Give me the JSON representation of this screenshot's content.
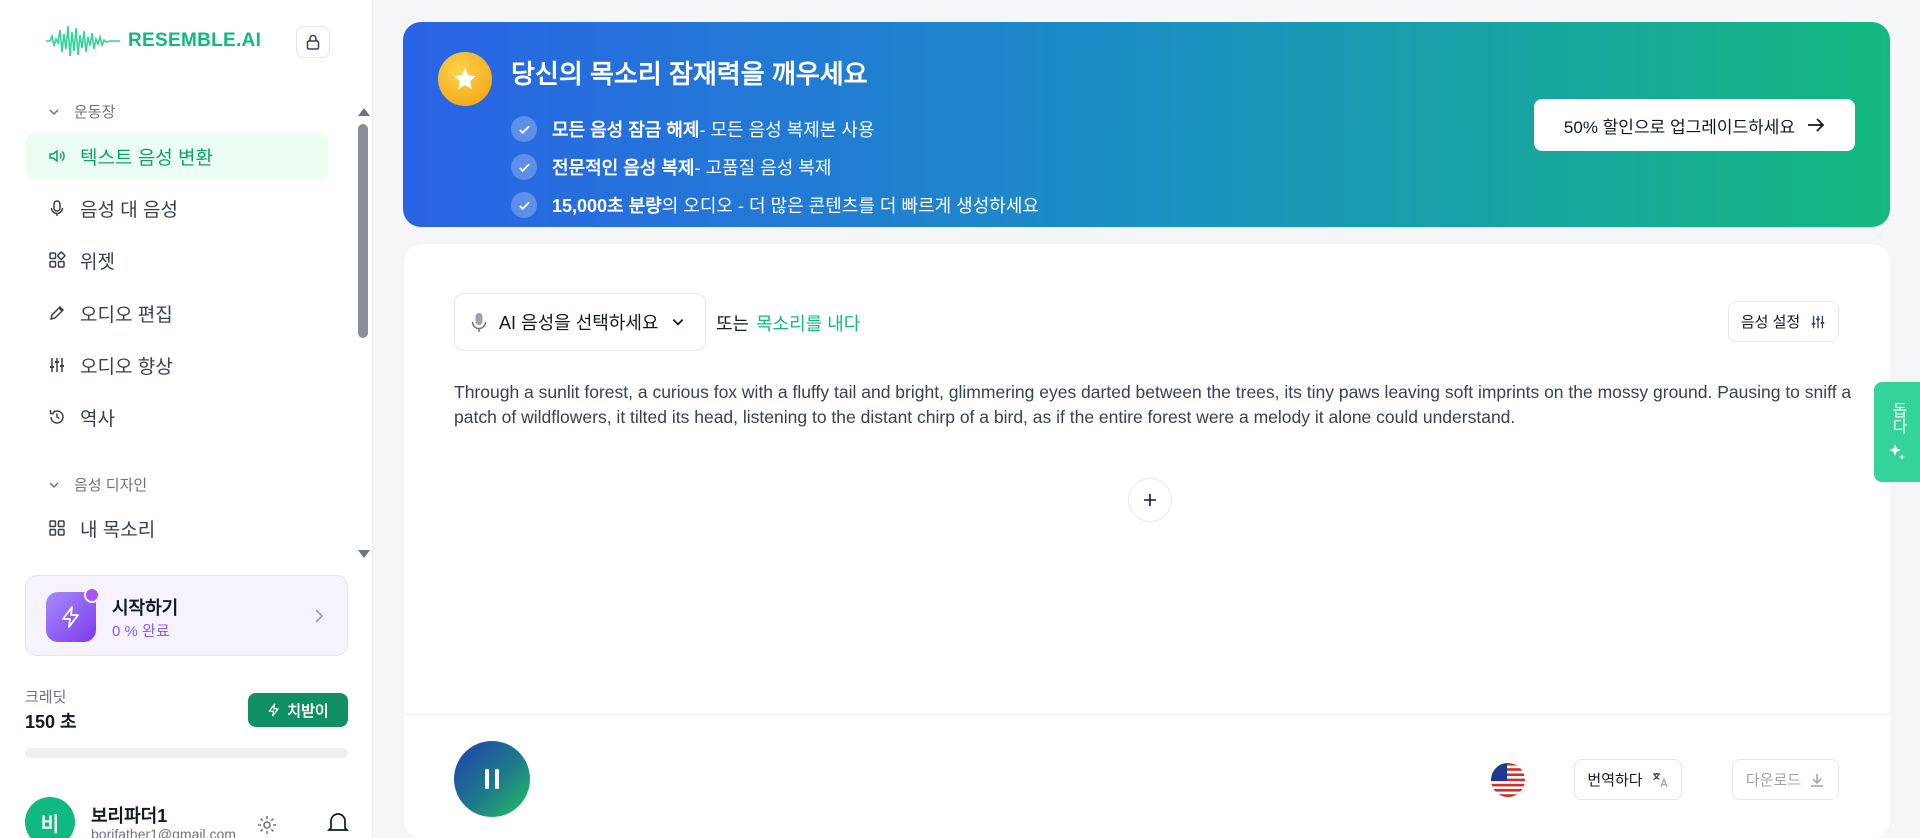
{
  "app": {
    "brand": "RESEMBLE.AI",
    "brand_color": "#10b981"
  },
  "sidebar": {
    "section_workspace": "운동장",
    "items_workspace": [
      {
        "label": "텍스트 음성 변환",
        "icon": "speaker-icon",
        "active": true
      },
      {
        "label": "음성 대 음성",
        "icon": "microphone-icon",
        "active": false
      },
      {
        "label": "위젯",
        "icon": "widgets-icon",
        "active": false
      },
      {
        "label": "오디오 편집",
        "icon": "pencil-icon",
        "active": false
      },
      {
        "label": "오디오 향상",
        "icon": "sliders-icon",
        "active": false
      },
      {
        "label": "역사",
        "icon": "history-icon",
        "active": false
      }
    ],
    "section_voice_design": "음성 디자인",
    "items_voice_design": [
      {
        "label": "내 목소리",
        "icon": "grid-icon",
        "active": false
      }
    ]
  },
  "onboarding": {
    "title": "시작하기",
    "progress_text": "0 % 완료"
  },
  "credits": {
    "label": "크레딧",
    "value": "150 초",
    "topup_label": "치받이",
    "remaining_fraction": 0.0
  },
  "user": {
    "initial": "비",
    "name": "보리파더1",
    "email": "borifather1@gmail.com"
  },
  "banner": {
    "title": "당신의 목소리 잠재력을 깨우세요",
    "features": [
      {
        "bold": "모든 음성 잠금 해제",
        "rest": " - 모든 음성 복제본 사용"
      },
      {
        "bold": "전문적인 음성 복제",
        "rest": " - 고품질 음성 복제"
      },
      {
        "bold": "15,000초 분량",
        "rest": " 의 오디오 - 더 많은 콘텐츠를 더 빠르게 생성하세요"
      }
    ],
    "upgrade_label": "50% 할인으로 업그레이드하세요"
  },
  "editor": {
    "voice_select_label": "AI 음성을 선택하세요",
    "or_text": "또는",
    "clone_link": "목소리를 내다",
    "voice_settings_label": "음성 설정",
    "script": "Through a sunlit forest, a curious fox with a fluffy tail and bright, glimmering eyes darted between the trees, its tiny paws leaving soft imprints on the mossy ground. Pausing to sniff a patch of wildflowers, it tilted its head, listening to the distant chirp of a bird, as if the entire forest were a melody it alone could understand."
  },
  "player": {
    "translate_label": "번역하다",
    "download_label": "다운로드",
    "language_flag": "us-flag-icon"
  },
  "float_tab": {
    "label": "돕다"
  }
}
